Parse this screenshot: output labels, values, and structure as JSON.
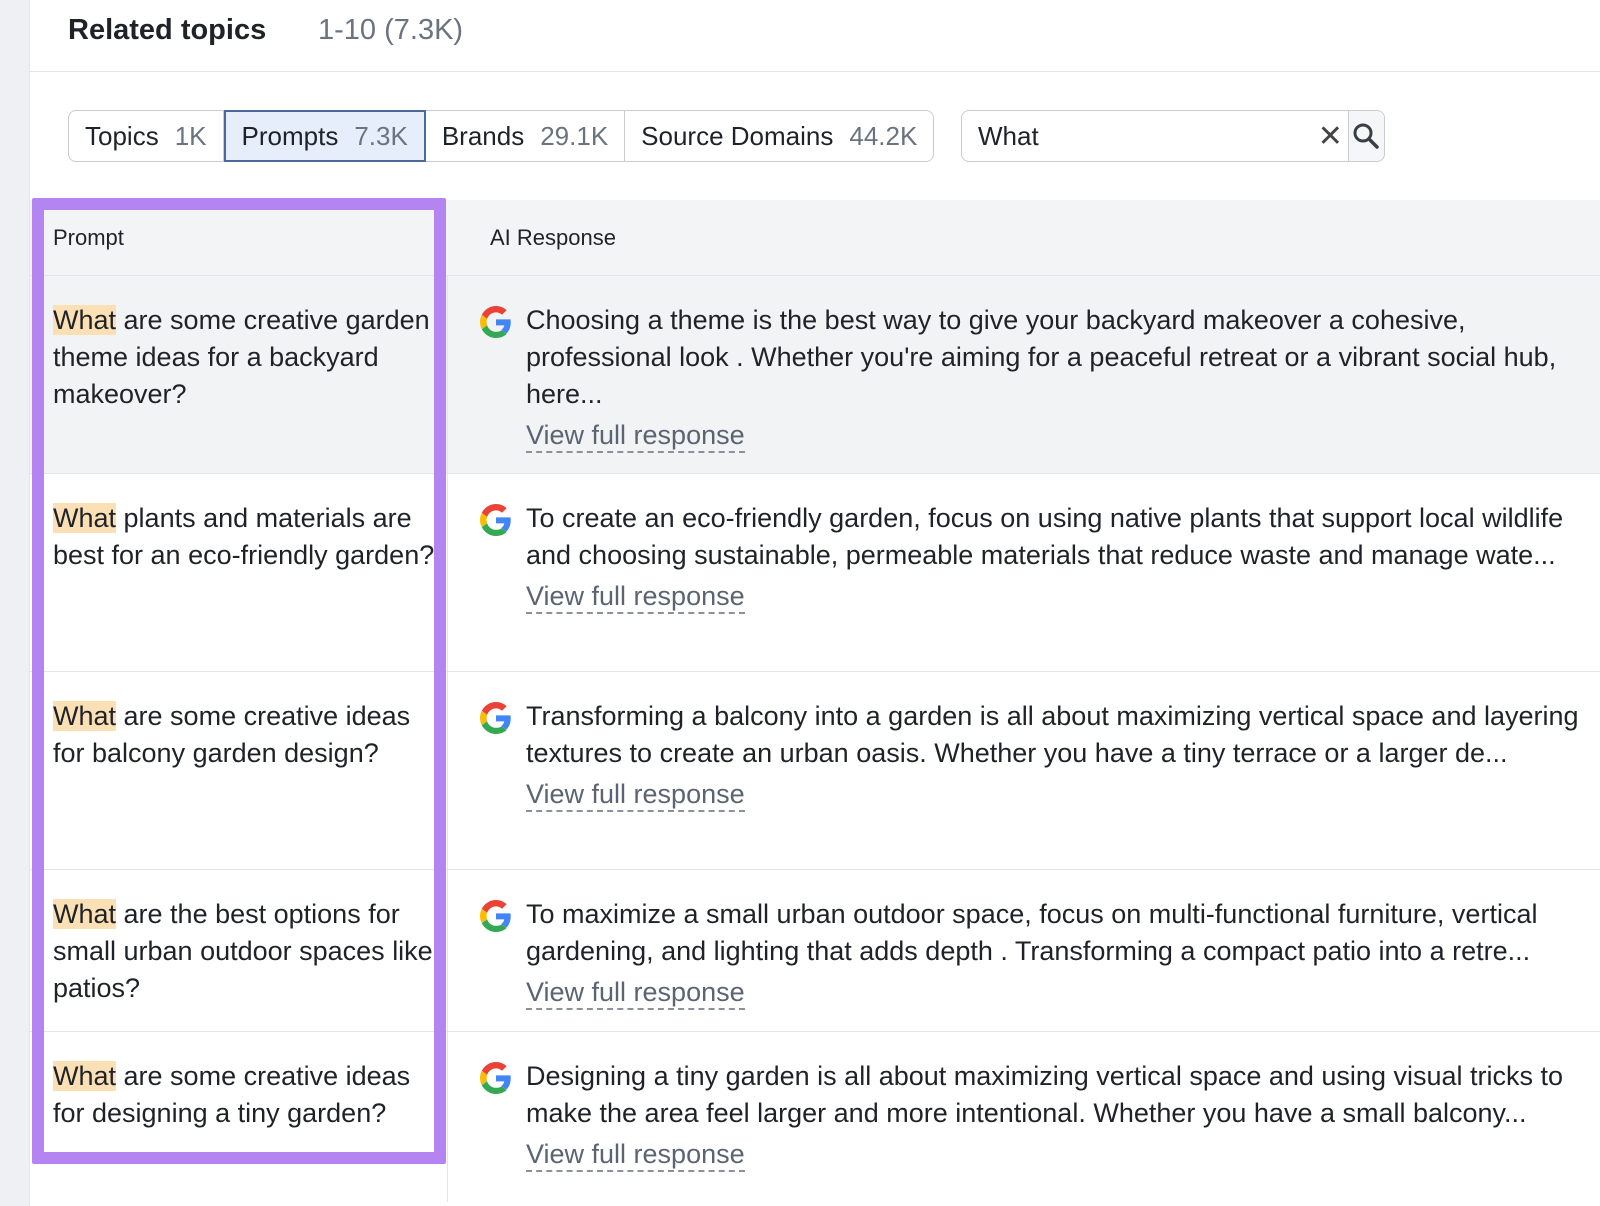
{
  "header": {
    "title": "Related topics",
    "range": "1-10 (7.3K)"
  },
  "tabs": [
    {
      "label": "Topics",
      "count": "1K"
    },
    {
      "label": "Prompts",
      "count": "7.3K"
    },
    {
      "label": "Brands",
      "count": "29.1K"
    },
    {
      "label": "Source Domains",
      "count": "44.2K"
    }
  ],
  "active_tab": "Prompts",
  "search": {
    "value": "What",
    "clear_icon": "close-icon",
    "search_icon": "search-icon"
  },
  "table": {
    "columns": {
      "prompt": "Prompt",
      "response": "AI Response"
    },
    "link_label": "View full response",
    "rows": [
      {
        "keyword": "What",
        "prompt_rest": " are some creative garden theme ideas for a backyard makeover?",
        "response": "Choosing a theme is the best way to give your backyard makeover a cohesive, professional look . Whether you're aiming for a peaceful retreat or a vibrant social hub, here..."
      },
      {
        "keyword": "What",
        "prompt_rest": " plants and materials are best for an eco-friendly garden?",
        "response": "To create an eco-friendly garden, focus on using native plants that support local wildlife and choosing sustainable, permeable materials that reduce waste and manage wate..."
      },
      {
        "keyword": "What",
        "prompt_rest": " are some creative ideas for balcony garden design?",
        "response": "Transforming a balcony into a garden is all about maximizing vertical space and layering textures to create an urban oasis. Whether you have a tiny terrace or a larger de..."
      },
      {
        "keyword": "What",
        "prompt_rest": " are the best options for small urban outdoor spaces like patios?",
        "response": "To maximize a small urban outdoor space, focus on multi-functional furniture, vertical gardening, and lighting that adds depth . Transforming a compact patio into a retre..."
      },
      {
        "keyword": "What",
        "prompt_rest": " are some creative ideas for designing a tiny garden?",
        "response": "Designing a tiny garden is all about maximizing vertical space and using visual tricks to make the area feel larger and more intentional. Whether you have a small balcony..."
      }
    ]
  },
  "colors": {
    "highlight_box": "#b484f0",
    "keyword_highlight": "#fbe0b5",
    "active_tab_bg": "#e6eefb"
  }
}
